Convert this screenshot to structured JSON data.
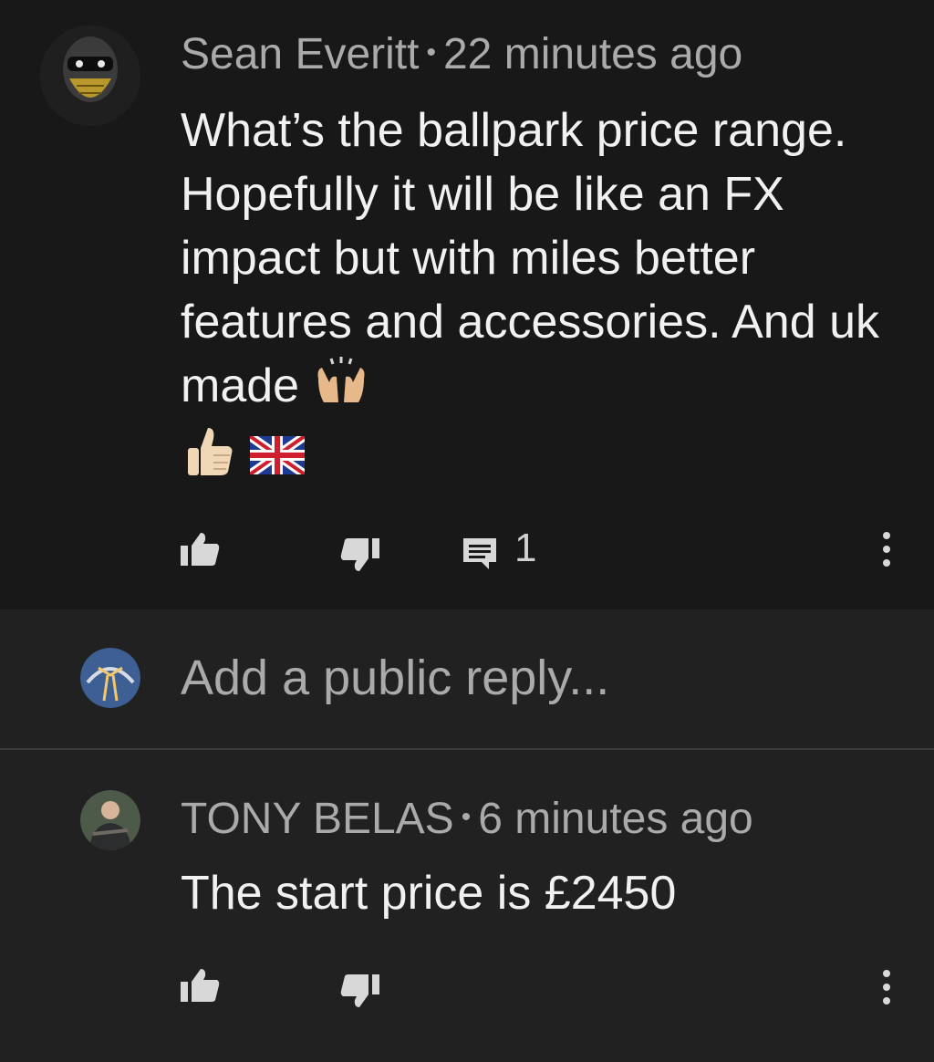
{
  "comment1": {
    "author": "Sean Everitt",
    "separator": "•",
    "time": "22 minutes ago",
    "text": "What’s the ballpark price range. Hopefully it will be like an FX impact but with miles better features and accessories. And uk made",
    "emojis": [
      "raising-hands-icon",
      "thumbs-up-icon",
      "uk-flag-icon"
    ],
    "reply_count": "1",
    "avatar_icon": "masked-skull-avatar"
  },
  "reply_box": {
    "placeholder": "Add a public reply...",
    "avatar_icon": "user-avatar"
  },
  "comment2": {
    "author": "TONY BELAS",
    "separator": "•",
    "time": "6 minutes ago",
    "text": "The start price is £2450",
    "avatar_icon": "person-photo-avatar"
  },
  "colors": {
    "background": "#181818",
    "panel": "#212121",
    "text": "#f1f1f1",
    "muted": "#aaaaaa"
  }
}
